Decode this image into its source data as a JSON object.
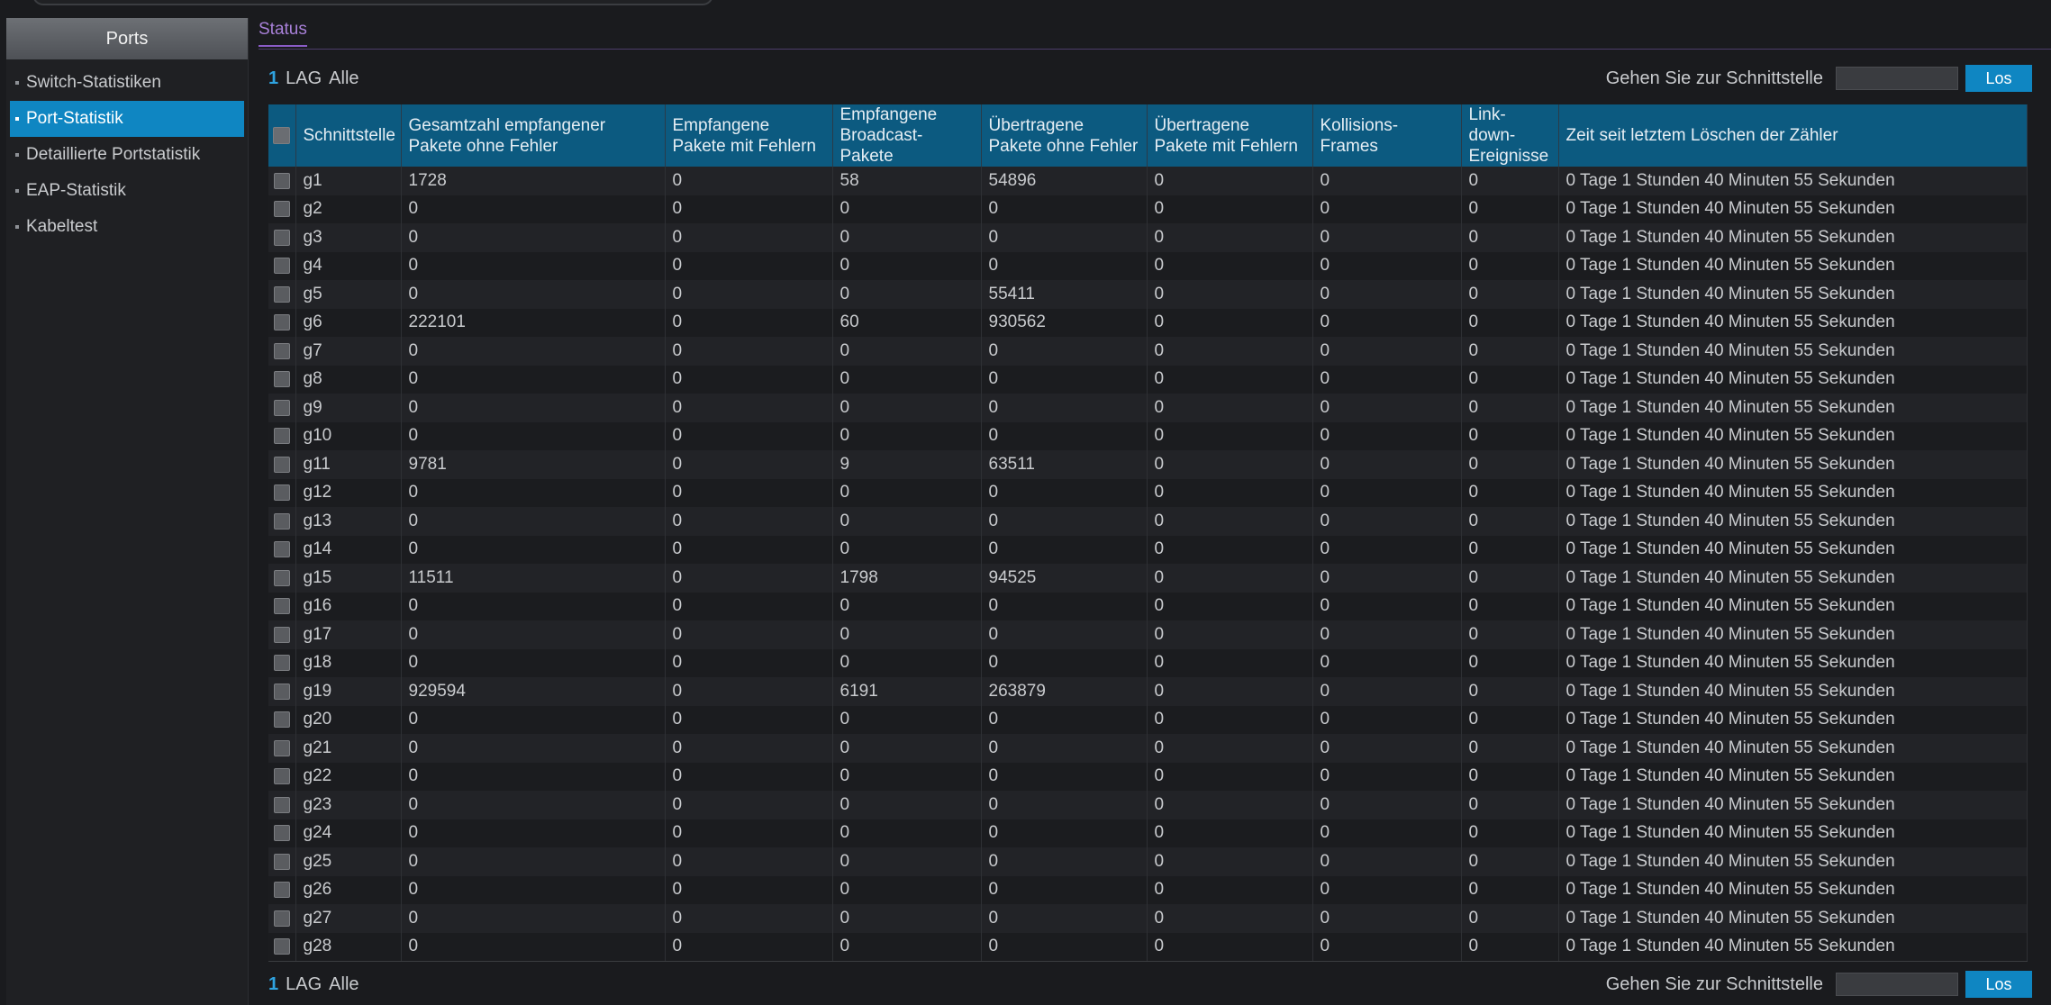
{
  "sidebar": {
    "header": "Ports",
    "items": [
      {
        "label": "Switch-Statistiken",
        "active": false
      },
      {
        "label": "Port-Statistik",
        "active": true
      },
      {
        "label": "Detaillierte Portstatistik",
        "active": false
      },
      {
        "label": "EAP-Statistik",
        "active": false
      },
      {
        "label": "Kabeltest",
        "active": false
      }
    ]
  },
  "tabs": {
    "status": "Status"
  },
  "filter": {
    "count": "1",
    "lag": "LAG",
    "all": "Alle"
  },
  "goto": {
    "label": "Gehen Sie zur Schnittstelle",
    "value": "",
    "button": "Los"
  },
  "table": {
    "headers": [
      "Schnittstelle",
      "Gesamtzahl empfangener Pakete ohne Fehler",
      "Empfangene Pakete mit Fehlern",
      "Empfangene Broadcast-Pakete",
      "Übertragene Pakete ohne Fehler",
      "Übertragene Pakete mit Fehlern",
      "Kollisions-Frames",
      "Link-down-Ereignisse",
      "Zeit seit letztem Löschen der Zähler"
    ],
    "rows": [
      [
        "g1",
        "1728",
        "0",
        "58",
        "54896",
        "0",
        "0",
        "0",
        "0 Tage 1 Stunden 40 Minuten 55 Sekunden"
      ],
      [
        "g2",
        "0",
        "0",
        "0",
        "0",
        "0",
        "0",
        "0",
        "0 Tage 1 Stunden 40 Minuten 55 Sekunden"
      ],
      [
        "g3",
        "0",
        "0",
        "0",
        "0",
        "0",
        "0",
        "0",
        "0 Tage 1 Stunden 40 Minuten 55 Sekunden"
      ],
      [
        "g4",
        "0",
        "0",
        "0",
        "0",
        "0",
        "0",
        "0",
        "0 Tage 1 Stunden 40 Minuten 55 Sekunden"
      ],
      [
        "g5",
        "0",
        "0",
        "0",
        "55411",
        "0",
        "0",
        "0",
        "0 Tage 1 Stunden 40 Minuten 55 Sekunden"
      ],
      [
        "g6",
        "222101",
        "0",
        "60",
        "930562",
        "0",
        "0",
        "0",
        "0 Tage 1 Stunden 40 Minuten 55 Sekunden"
      ],
      [
        "g7",
        "0",
        "0",
        "0",
        "0",
        "0",
        "0",
        "0",
        "0 Tage 1 Stunden 40 Minuten 55 Sekunden"
      ],
      [
        "g8",
        "0",
        "0",
        "0",
        "0",
        "0",
        "0",
        "0",
        "0 Tage 1 Stunden 40 Minuten 55 Sekunden"
      ],
      [
        "g9",
        "0",
        "0",
        "0",
        "0",
        "0",
        "0",
        "0",
        "0 Tage 1 Stunden 40 Minuten 55 Sekunden"
      ],
      [
        "g10",
        "0",
        "0",
        "0",
        "0",
        "0",
        "0",
        "0",
        "0 Tage 1 Stunden 40 Minuten 55 Sekunden"
      ],
      [
        "g11",
        "9781",
        "0",
        "9",
        "63511",
        "0",
        "0",
        "0",
        "0 Tage 1 Stunden 40 Minuten 55 Sekunden"
      ],
      [
        "g12",
        "0",
        "0",
        "0",
        "0",
        "0",
        "0",
        "0",
        "0 Tage 1 Stunden 40 Minuten 55 Sekunden"
      ],
      [
        "g13",
        "0",
        "0",
        "0",
        "0",
        "0",
        "0",
        "0",
        "0 Tage 1 Stunden 40 Minuten 55 Sekunden"
      ],
      [
        "g14",
        "0",
        "0",
        "0",
        "0",
        "0",
        "0",
        "0",
        "0 Tage 1 Stunden 40 Minuten 55 Sekunden"
      ],
      [
        "g15",
        "11511",
        "0",
        "1798",
        "94525",
        "0",
        "0",
        "0",
        "0 Tage 1 Stunden 40 Minuten 55 Sekunden"
      ],
      [
        "g16",
        "0",
        "0",
        "0",
        "0",
        "0",
        "0",
        "0",
        "0 Tage 1 Stunden 40 Minuten 55 Sekunden"
      ],
      [
        "g17",
        "0",
        "0",
        "0",
        "0",
        "0",
        "0",
        "0",
        "0 Tage 1 Stunden 40 Minuten 55 Sekunden"
      ],
      [
        "g18",
        "0",
        "0",
        "0",
        "0",
        "0",
        "0",
        "0",
        "0 Tage 1 Stunden 40 Minuten 55 Sekunden"
      ],
      [
        "g19",
        "929594",
        "0",
        "6191",
        "263879",
        "0",
        "0",
        "0",
        "0 Tage 1 Stunden 40 Minuten 55 Sekunden"
      ],
      [
        "g20",
        "0",
        "0",
        "0",
        "0",
        "0",
        "0",
        "0",
        "0 Tage 1 Stunden 40 Minuten 55 Sekunden"
      ],
      [
        "g21",
        "0",
        "0",
        "0",
        "0",
        "0",
        "0",
        "0",
        "0 Tage 1 Stunden 40 Minuten 55 Sekunden"
      ],
      [
        "g22",
        "0",
        "0",
        "0",
        "0",
        "0",
        "0",
        "0",
        "0 Tage 1 Stunden 40 Minuten 55 Sekunden"
      ],
      [
        "g23",
        "0",
        "0",
        "0",
        "0",
        "0",
        "0",
        "0",
        "0 Tage 1 Stunden 40 Minuten 55 Sekunden"
      ],
      [
        "g24",
        "0",
        "0",
        "0",
        "0",
        "0",
        "0",
        "0",
        "0 Tage 1 Stunden 40 Minuten 55 Sekunden"
      ],
      [
        "g25",
        "0",
        "0",
        "0",
        "0",
        "0",
        "0",
        "0",
        "0 Tage 1 Stunden 40 Minuten 55 Sekunden"
      ],
      [
        "g26",
        "0",
        "0",
        "0",
        "0",
        "0",
        "0",
        "0",
        "0 Tage 1 Stunden 40 Minuten 55 Sekunden"
      ],
      [
        "g27",
        "0",
        "0",
        "0",
        "0",
        "0",
        "0",
        "0",
        "0 Tage 1 Stunden 40 Minuten 55 Sekunden"
      ],
      [
        "g28",
        "0",
        "0",
        "0",
        "0",
        "0",
        "0",
        "0",
        "0 Tage 1 Stunden 40 Minuten 55 Sekunden"
      ]
    ]
  },
  "colors": {
    "accent": "#0f86c2",
    "header_bg": "#0c5a80",
    "tab_active": "#a880d8"
  }
}
